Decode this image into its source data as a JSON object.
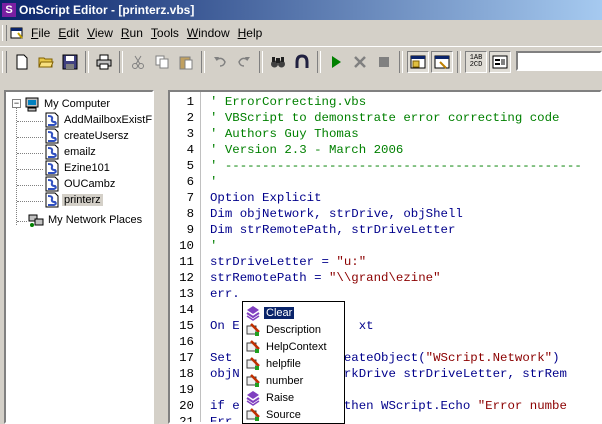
{
  "window": {
    "title": "OnScript Editor - [printerz.vbs]",
    "app_icon_glyph": "S"
  },
  "menu": {
    "items": [
      {
        "name": "file",
        "acc": "F",
        "rest": "ile"
      },
      {
        "name": "edit",
        "acc": "E",
        "rest": "dit"
      },
      {
        "name": "view",
        "acc": "V",
        "rest": "iew"
      },
      {
        "name": "run",
        "acc": "R",
        "rest": "un"
      },
      {
        "name": "tools",
        "acc": "T",
        "rest": "ools"
      },
      {
        "name": "window",
        "acc": "W",
        "rest": "indow"
      },
      {
        "name": "help",
        "acc": "H",
        "rest": "elp"
      }
    ]
  },
  "toolbar": {
    "buttons": [
      "new-file-icon",
      "open-folder-icon",
      "save-icon",
      "print-icon",
      "cut-icon",
      "copy-icon",
      "paste-icon",
      "undo-icon",
      "redo-icon",
      "find-icon",
      "replace-icon",
      "run-icon",
      "stop-icon",
      "pause-icon",
      "window-view-icon",
      "code-view-icon",
      "line-numbers-icon",
      "properties-icon"
    ],
    "line_numbers_label": "1AB 2CD"
  },
  "tree": {
    "root": "My Computer",
    "children": [
      "AddMailboxExistF",
      "createUsersz",
      "emailz",
      "Ezine101",
      "OUCambz",
      "printerz"
    ],
    "network": "My Network Places",
    "selected": "printerz"
  },
  "editor": {
    "line_numbers": [
      "1",
      "2",
      "3",
      "4",
      "5",
      "6",
      "7",
      "8",
      "9",
      "10",
      "11",
      "12",
      "13",
      "14",
      "15",
      "16",
      "17",
      "18",
      "19",
      "20",
      "21"
    ],
    "lines": [
      [
        {
          "t": "' ErrorCorrecting.vbs",
          "c": "comment"
        }
      ],
      [
        {
          "t": "' VBScript to demonstrate error correcting code",
          "c": "comment"
        }
      ],
      [
        {
          "t": "' Authors Guy Thomas",
          "c": "comment"
        }
      ],
      [
        {
          "t": "' Version 2.3 - March 2006",
          "c": "comment"
        }
      ],
      [
        {
          "t": "' ------------------------------------------------",
          "c": "comment"
        }
      ],
      [
        {
          "t": "'",
          "c": "comment"
        }
      ],
      [
        {
          "t": "Option Explicit",
          "c": "kw"
        }
      ],
      [
        {
          "t": "Dim objNetwork, strDrive, objShell",
          "c": "kw"
        }
      ],
      [
        {
          "t": "Dim strRemotePath, strDriveLetter",
          "c": "kw"
        }
      ],
      [
        {
          "t": "'",
          "c": "comment"
        }
      ],
      [
        {
          "t": "strDriveLetter = ",
          "c": "plain"
        },
        {
          "t": "\"u:\"",
          "c": "str"
        }
      ],
      [
        {
          "t": "strRemotePath = ",
          "c": "plain"
        },
        {
          "t": "\"\\\\grand\\ezine\"",
          "c": "str"
        }
      ],
      [
        {
          "t": "err.",
          "c": "plain"
        }
      ],
      [
        {
          "t": "",
          "c": "plain"
        }
      ],
      [
        {
          "t": "On E",
          "c": "kw"
        },
        {
          "t": "                ",
          "c": "plain"
        },
        {
          "t": "xt",
          "c": "kw"
        }
      ],
      [
        {
          "t": "",
          "c": "plain"
        }
      ],
      [
        {
          "t": "Set ",
          "c": "kw"
        },
        {
          "t": "            ",
          "c": "plain"
        },
        {
          "t": "CreateObject(",
          "c": "plain"
        },
        {
          "t": "\"WScript.Network\"",
          "c": "str"
        },
        {
          "t": ")",
          "c": "plain"
        }
      ],
      [
        {
          "t": "objN",
          "c": "plain"
        },
        {
          "t": "            ",
          "c": "plain"
        },
        {
          "t": "workDrive strDriveLetter, strRem",
          "c": "plain"
        }
      ],
      [
        {
          "t": "",
          "c": "plain"
        }
      ],
      [
        {
          "t": "if e",
          "c": "kw"
        },
        {
          "t": "            ",
          "c": "plain"
        },
        {
          "t": "0 then WScript.Echo ",
          "c": "plain"
        },
        {
          "t": "\"Error numbe",
          "c": "str"
        }
      ],
      [
        {
          "t": "Err.",
          "c": "plain"
        }
      ]
    ]
  },
  "autocomplete": {
    "items": [
      {
        "label": "Clear",
        "icon": "method-icon",
        "selected": true
      },
      {
        "label": "Description",
        "icon": "property-icon",
        "selected": false
      },
      {
        "label": "HelpContext",
        "icon": "property-icon",
        "selected": false
      },
      {
        "label": "helpfile",
        "icon": "property-icon",
        "selected": false
      },
      {
        "label": "number",
        "icon": "property-icon",
        "selected": false
      },
      {
        "label": "Raise",
        "icon": "method-icon",
        "selected": false
      },
      {
        "label": "Source",
        "icon": "property-icon",
        "selected": false
      }
    ]
  }
}
